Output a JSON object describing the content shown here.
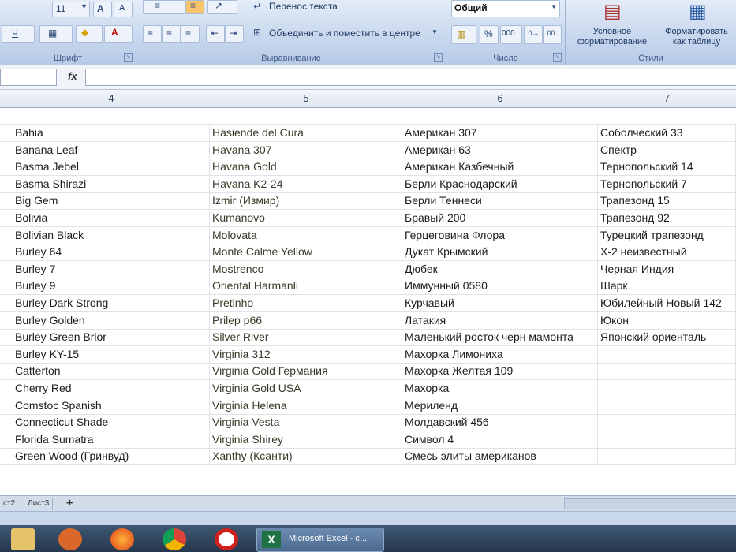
{
  "ribbon": {
    "font": {
      "size": "11",
      "group_label": "Шрифт"
    },
    "alignment": {
      "wrap_text": "Перенос текста",
      "merge_center": "Объединить и поместить в центре",
      "group_label": "Выравнивание"
    },
    "number": {
      "format": "Общий",
      "group_label": "Число"
    },
    "styles": {
      "conditional_formatting": "Условное форматирование",
      "format_as_table": "Форматировать как таблицу",
      "group_label": "Стили"
    }
  },
  "formula_bar": {
    "fx": "fx"
  },
  "columns": [
    "4",
    "5",
    "6",
    "7"
  ],
  "rows": [
    [
      "Bahia",
      "Hasiende del Cura",
      "Американ 307",
      "Соболческий 33"
    ],
    [
      "Banana Leaf",
      "Havana 307",
      "Американ 63",
      "Спектр"
    ],
    [
      "Basma Jebel",
      "Havana Gold",
      "Американ Казбечный",
      "Тернопольский 14"
    ],
    [
      "Basma Shirazi",
      "Havana K2-24",
      "Берли Краснодарский",
      "Тернопольский 7"
    ],
    [
      "Big Gem",
      "Izmir (Измир)",
      "Берли Теннеси",
      "Трапезонд 15"
    ],
    [
      "Bolivia",
      "Kumanovo",
      "Бравый 200",
      "Трапезонд 92"
    ],
    [
      "Bolivian Black",
      "Molovata",
      "Герцеговина Флора",
      "Турецкий трапезонд"
    ],
    [
      "Burley 64",
      "Monte Calme Yellow",
      "Дукат Крымский",
      "Х-2 неизвестный"
    ],
    [
      "Burley 7",
      "Mostrenco",
      "Дюбек",
      "Черная Индия"
    ],
    [
      "Burley 9",
      "Oriental Harmanli",
      "Иммунный 0580",
      "Шарк"
    ],
    [
      "Burley Dark Strong",
      "Pretinho",
      "Курчавый",
      "Юбилейный Новый 142"
    ],
    [
      "Burley Golden",
      "Prilep p66",
      "Латакия",
      "Юкон"
    ],
    [
      "Burley Green Brior",
      "Silver River",
      "Маленький росток черн мамонта",
      "Японский ориенталь"
    ],
    [
      "Burley KY-15",
      "Virginia 312",
      "Махорка Лимониха",
      ""
    ],
    [
      "Catterton",
      "Virginia Gold Германия",
      "Махорка Желтая 109",
      ""
    ],
    [
      "Cherry Red",
      "Virginia Gold USA",
      "Махорка",
      ""
    ],
    [
      "Comstoc Spanish",
      "Virginia Helena",
      "Мериленд",
      ""
    ],
    [
      "Connecticut Shade",
      "Virginia Vesta",
      "Молдавский 456",
      ""
    ],
    [
      "Florida Sumatra",
      "Virginia Shirey",
      "Символ 4",
      ""
    ],
    [
      "Green Wood (Гринвуд)",
      "Xanthy (Ксанти)",
      "Смесь элиты американов",
      ""
    ]
  ],
  "sheet_tabs": [
    "ст2",
    "Лист3"
  ],
  "taskbar": {
    "active_app": "Microsoft Excel - c..."
  }
}
